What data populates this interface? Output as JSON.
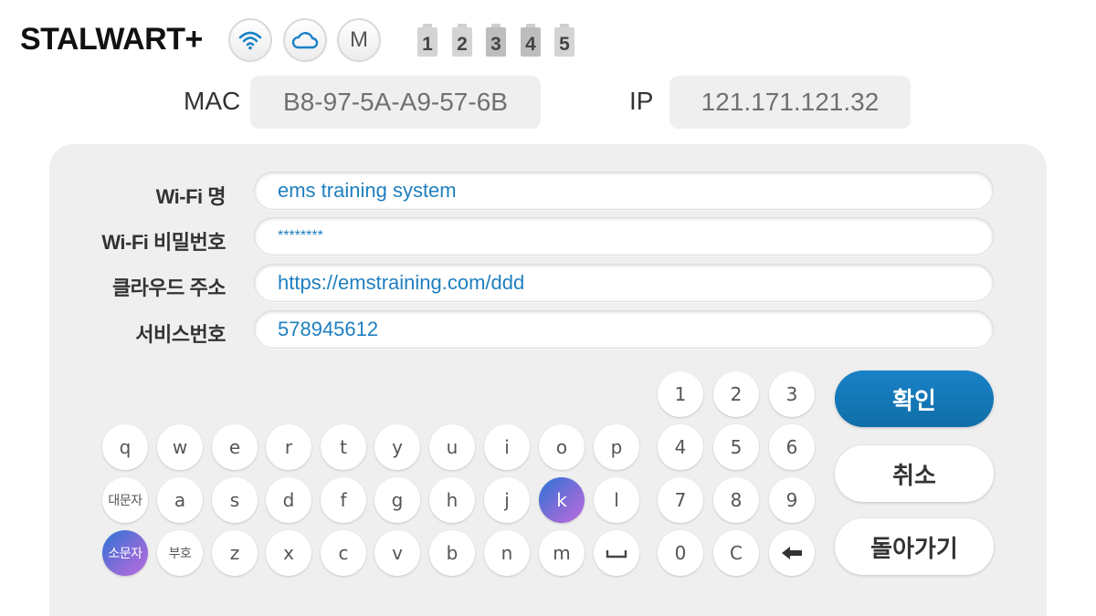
{
  "header": {
    "brand": "STALWART+",
    "mode_label": "M",
    "channels": [
      "1",
      "2",
      "3",
      "4",
      "5"
    ]
  },
  "device": {
    "mac_label": "MAC",
    "mac_value": "B8-97-5A-A9-57-6B",
    "ip_label": "IP",
    "ip_value": "121.171.121.32"
  },
  "form": {
    "fields": [
      {
        "label": "Wi-Fi 명",
        "value": "ems training system"
      },
      {
        "label": "Wi-Fi 비밀번호",
        "value": "********"
      },
      {
        "label": "클라우드 주소",
        "value": "https://emstraining.com/ddd"
      },
      {
        "label": "서비스번호",
        "value": "578945612"
      }
    ]
  },
  "keyboard": {
    "row1": [
      "q",
      "w",
      "e",
      "r",
      "t",
      "y",
      "u",
      "i",
      "o",
      "p"
    ],
    "row2": [
      "대문자",
      "a",
      "s",
      "d",
      "f",
      "g",
      "h",
      "j",
      "k",
      "l"
    ],
    "row3": [
      "소문자",
      "부호",
      "z",
      "x",
      "c",
      "v",
      "b",
      "n",
      "m",
      "␣"
    ],
    "numpad": [
      "1",
      "2",
      "3",
      "4",
      "5",
      "6",
      "7",
      "8",
      "9",
      "0",
      "C",
      "⬅"
    ],
    "active_keys": [
      "k",
      "소문자"
    ]
  },
  "actions": {
    "confirm": "확인",
    "cancel": "취소",
    "back": "돌아가기"
  },
  "colors": {
    "accent": "#1478bd",
    "field_text": "#1f7fbf",
    "panel_bg": "#efefef"
  },
  "icons": {
    "wifi": "wifi-icon",
    "cloud": "cloud-icon",
    "backspace": "backspace-arrow-icon",
    "space": "space-bar-icon"
  }
}
